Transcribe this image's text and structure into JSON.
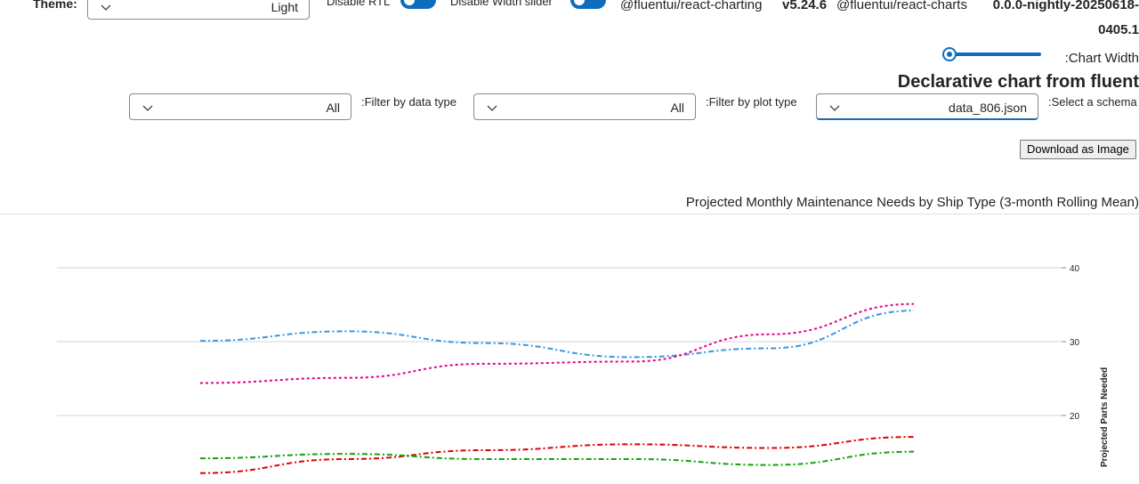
{
  "controls": {
    "theme_label": "Theme:",
    "theme_value": "Light",
    "disable_rtl_label": "Disable RTL",
    "disable_width_slider_label": "Disable Width slider",
    "pkg_charting_name": "@fluentui/react-charting",
    "pkg_charting_version": "v5.24.6",
    "pkg_charts_name": "@fluentui/react-charts",
    "pkg_charts_version_line1": "0.0.0-nightly-20250618-",
    "pkg_charts_version_line2": "0405.1",
    "chart_width_label": ":Chart Width",
    "chart_width_value": 0.0,
    "heading": "Declarative chart from fluent",
    "select_schema_label": ":Select a schema",
    "schema_value": "data_806.json",
    "filter_plot_label": ":Filter by plot type",
    "filter_plot_value": "All",
    "filter_data_label": ":Filter by data type",
    "filter_data_value": "All",
    "download_label": "Download as Image"
  },
  "chart_data": {
    "type": "line",
    "title": "Projected Monthly Maintenance Needs by Ship Type (3-month Rolling Mean)",
    "ylabel": "Projected Parts Needed",
    "ylim": [
      10,
      40
    ],
    "yticks": [
      20,
      30,
      40
    ],
    "grid": true,
    "series": [
      {
        "color": "#3a96dd",
        "dash": "6,3,2,3",
        "values": [
          30.1,
          31.4,
          29.8,
          27.9,
          29.1,
          34.2
        ]
      },
      {
        "color": "#e3008c",
        "dash": "3,3",
        "values": [
          24.4,
          25.1,
          27.0,
          27.3,
          31.0,
          35.1
        ]
      },
      {
        "color": "#e00000",
        "dash": "6,3,2,3",
        "values": [
          12.2,
          14.1,
          15.3,
          16.1,
          15.6,
          17.1
        ]
      },
      {
        "color": "#13a10e",
        "dash": "6,3,2,3",
        "values": [
          14.2,
          14.8,
          14.1,
          14.1,
          13.3,
          15.1
        ]
      }
    ]
  }
}
